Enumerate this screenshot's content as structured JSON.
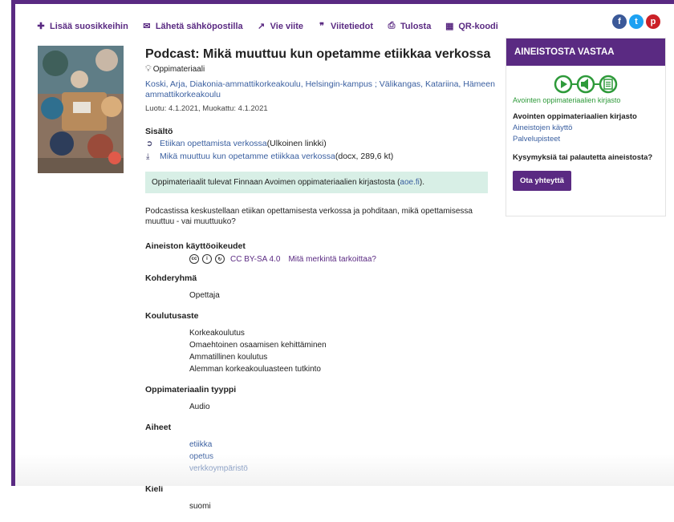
{
  "toolbar": {
    "items": [
      {
        "label": "Lisää suosikkeihin",
        "icon": "pin-icon"
      },
      {
        "label": "Lähetä sähköpostilla",
        "icon": "mail-icon"
      },
      {
        "label": "Vie viite",
        "icon": "export-icon"
      },
      {
        "label": "Viitetiedot",
        "icon": "quote-icon"
      },
      {
        "label": "Tulosta",
        "icon": "print-icon"
      },
      {
        "label": "QR-koodi",
        "icon": "qr-icon"
      }
    ]
  },
  "social": {
    "facebook": "f",
    "twitter": "t",
    "pinterest": "p"
  },
  "record": {
    "title": "Podcast: Mikä muuttuu kun opetamme etiikkaa verkossa",
    "format": "Oppimateriaali",
    "authors": "Koski, Arja, Diakonia-ammattikorkeakoulu, Helsingin-kampus ; Välikangas, Katariina, Hämeen ammattikorkeakoulu",
    "dates": "Luotu: 4.1.2021, Muokattu: 4.1.2021",
    "content_heading": "Sisältö",
    "content_links": [
      {
        "text": "Etiikan opettamista verkossa",
        "suffix": " (Ulkoinen linkki)"
      },
      {
        "text": "Mikä muuttuu kun opetamme etiikkaa verkossa",
        "suffix": " (docx, 289,6 kt)"
      }
    ],
    "info_prefix": "Oppimateriaalit tulevat Finnaan Avoimen oppimateriaalien kirjastosta (",
    "info_link": "aoe.fi",
    "info_suffix": ").",
    "description": "Podcastissa keskustellaan etiikan opettamisesta verkossa ja pohditaan, mikä opettamisessa muuttuu - vai muuttuuko?",
    "rights_heading": "Aineiston käyttöoikeudet",
    "license": "CC BY-SA 4.0",
    "license_help": "Mitä merkintä tarkoittaa?",
    "target_heading": "Kohderyhmä",
    "target": [
      "Opettaja"
    ],
    "level_heading": "Koulutusaste",
    "levels": [
      "Korkeakoulutus",
      "Omaehtoinen osaamisen kehittäminen",
      "Ammatillinen koulutus",
      "Alemman korkeakouluasteen tutkinto"
    ],
    "type_heading": "Oppimateriaalin tyyppi",
    "types": [
      "Audio"
    ],
    "subjects_heading": "Aiheet",
    "subjects": [
      "etiikka",
      "opetus",
      "verkkoympäristö"
    ],
    "language_heading": "Kieli",
    "languages": [
      "suomi"
    ]
  },
  "sidebar": {
    "heading": "AINEISTOSTA VASTAA",
    "logo_text": "Avointen oppimateriaalien kirjasto",
    "org_name": "Avointen oppimateriaalien kirjasto",
    "links": [
      "Aineistojen käyttö",
      "Palvelupisteet"
    ],
    "question": "Kysymyksiä tai palautetta aineistosta?",
    "button": "Ota yhteyttä"
  },
  "colors": {
    "accent": "#5a2a82",
    "link": "#3a5fa0",
    "info_bg": "#d8efe6",
    "logo_green": "#2e9a3a"
  }
}
